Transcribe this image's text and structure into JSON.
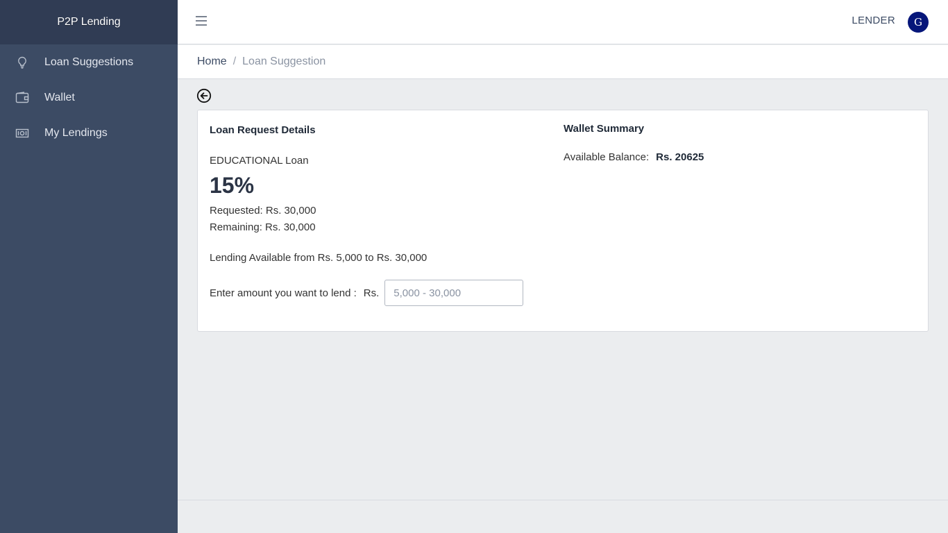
{
  "brand": "P2P Lending",
  "sidebar": {
    "items": [
      {
        "label": "Loan Suggestions",
        "icon": "lightbulb-icon"
      },
      {
        "label": "Wallet",
        "icon": "wallet-icon"
      },
      {
        "label": "My Lendings",
        "icon": "money-bill-icon"
      }
    ]
  },
  "header": {
    "role": "LENDER",
    "avatar_initial": "G",
    "avatar_color": "#06167a"
  },
  "breadcrumb": {
    "home": "Home",
    "separator": "/",
    "current": "Loan Suggestion"
  },
  "loan": {
    "title": "Loan Request Details",
    "type": "EDUCATIONAL Loan",
    "rate": "15%",
    "requested": "Requested: Rs. 30,000",
    "remaining": "Remaining: Rs. 30,000",
    "availability": "Lending Available from Rs. 5,000 to Rs. 30,000",
    "input_label": "Enter amount you want to lend :",
    "currency": "Rs.",
    "input_placeholder": "5,000 - 30,000",
    "input_value": ""
  },
  "wallet": {
    "title": "Wallet Summary",
    "balance_label": "Available Balance:",
    "balance_value": "Rs. 20625"
  }
}
